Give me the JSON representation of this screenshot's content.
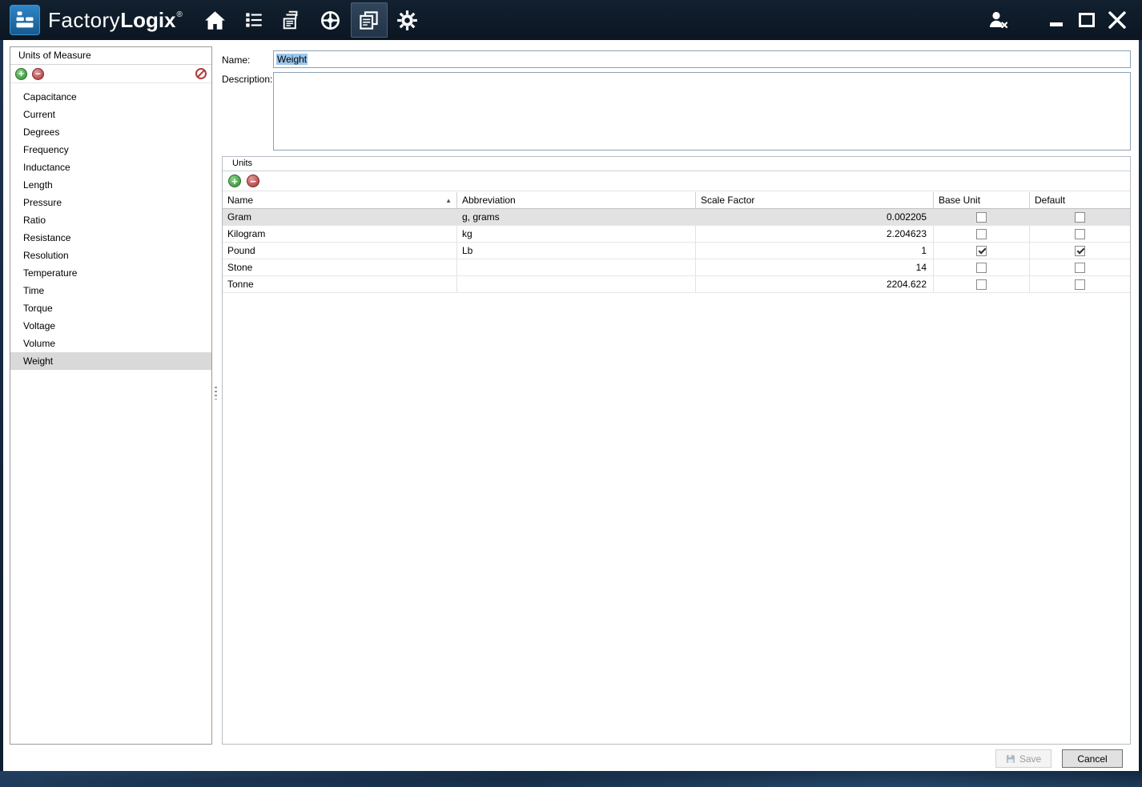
{
  "titlebar": {
    "brand_factory": "Factory",
    "brand_logix": "Logix",
    "brand_reg": "®",
    "nav_icons": [
      {
        "name": "home-icon",
        "selected": false
      },
      {
        "name": "checklist-icon",
        "selected": false
      },
      {
        "name": "documents-stack-icon",
        "selected": false
      },
      {
        "name": "compass-icon",
        "selected": false
      },
      {
        "name": "reports-window-icon",
        "selected": true
      },
      {
        "name": "gear-icon",
        "selected": false
      }
    ],
    "window_control_icons": [
      "logout-user-icon",
      "minimize-icon",
      "maximize-icon",
      "close-icon"
    ]
  },
  "sidebar": {
    "title": "Units of Measure",
    "toolbar_icons": [
      "add-icon",
      "remove-icon",
      "cancel-edit-icon"
    ],
    "items": [
      "Capacitance",
      "Current",
      "Degrees",
      "Frequency",
      "Inductance",
      "Length",
      "Pressure",
      "Ratio",
      "Resistance",
      "Resolution",
      "Temperature",
      "Time",
      "Torque",
      "Voltage",
      "Volume",
      "Weight"
    ],
    "selected_item": "Weight"
  },
  "form": {
    "name_label": "Name:",
    "name_value": "Weight",
    "name_value_selected": true,
    "description_label": "Description:",
    "description_value": ""
  },
  "units": {
    "group_title": "Units",
    "toolbar_icons": [
      "add-icon",
      "remove-icon"
    ],
    "columns": [
      "Name",
      "Abbreviation",
      "Scale Factor",
      "Base Unit",
      "Default"
    ],
    "sorted_column": "Name",
    "sort_direction": "ascending",
    "sort_glyph": "▲",
    "selected_row": "Gram",
    "rows": [
      {
        "name": "Gram",
        "abbreviation": "g, grams",
        "scale_factor": "0.002205",
        "base_unit": false,
        "default": false
      },
      {
        "name": "Kilogram",
        "abbreviation": "kg",
        "scale_factor": "2.204623",
        "base_unit": false,
        "default": false
      },
      {
        "name": "Pound",
        "abbreviation": "Lb",
        "scale_factor": "1",
        "base_unit": true,
        "default": true
      },
      {
        "name": "Stone",
        "abbreviation": "",
        "scale_factor": "14",
        "base_unit": false,
        "default": false
      },
      {
        "name": "Tonne",
        "abbreviation": "",
        "scale_factor": "2204.622",
        "base_unit": false,
        "default": false
      }
    ]
  },
  "footer": {
    "save_label": "Save",
    "save_enabled": false,
    "cancel_label": "Cancel"
  },
  "colors": {
    "titlebar_bg": "#0d1a28",
    "logo_blue": "#2079bc",
    "selection_blue": "#9cc7ec",
    "selected_row_bg": "#e2e2e2",
    "add_green": "#2f8b2f",
    "remove_red": "#a83232"
  }
}
